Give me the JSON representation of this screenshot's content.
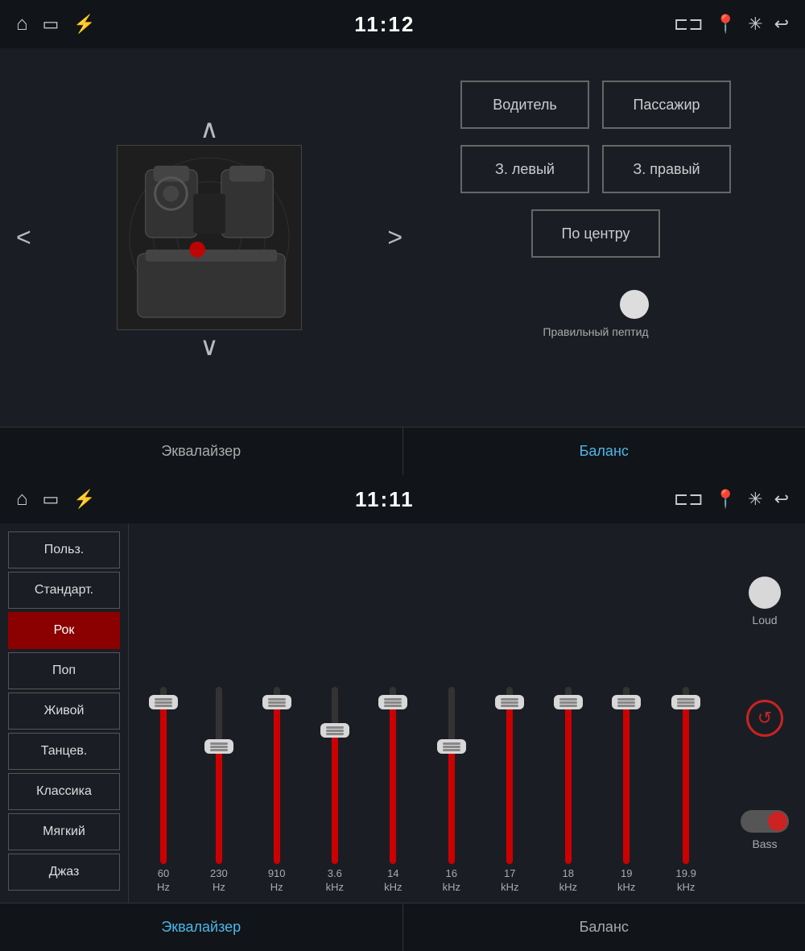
{
  "top": {
    "statusBar": {
      "time": "11:12"
    },
    "tabs": [
      {
        "label": "Эквалайзер",
        "active": false
      },
      {
        "label": "Баланс",
        "active": true
      }
    ],
    "balanceControls": {
      "up": "∧",
      "down": "∨",
      "left": "<",
      "right": ">",
      "btn_driver": "Водитель",
      "btn_passenger": "Пассажир",
      "btn_rear_left": "З. левый",
      "btn_rear_right": "З. правый",
      "btn_center": "По центру",
      "label_correct": "Правильный пептид"
    }
  },
  "bottom": {
    "statusBar": {
      "time": "11:11"
    },
    "presets": [
      {
        "label": "Польз.",
        "active": false
      },
      {
        "label": "Стандарт.",
        "active": false
      },
      {
        "label": "Рок",
        "active": true
      },
      {
        "label": "Поп",
        "active": false
      },
      {
        "label": "Живой",
        "active": false
      },
      {
        "label": "Танцев.",
        "active": false
      },
      {
        "label": "Классика",
        "active": false
      },
      {
        "label": "Мягкий",
        "active": false
      },
      {
        "label": "Джаз",
        "active": false
      }
    ],
    "sliders": [
      {
        "freq": "60",
        "unit": "Hz",
        "fill": 88,
        "thumbTop": 10
      },
      {
        "freq": "230",
        "unit": "Hz",
        "fill": 65,
        "thumbTop": 65
      },
      {
        "freq": "910",
        "unit": "Hz",
        "fill": 88,
        "thumbTop": 10
      },
      {
        "freq": "3.6",
        "unit": "kHz",
        "fill": 75,
        "thumbTop": 45
      },
      {
        "freq": "14",
        "unit": "kHz",
        "fill": 88,
        "thumbTop": 10
      },
      {
        "freq": "16",
        "unit": "kHz",
        "fill": 65,
        "thumbTop": 65
      },
      {
        "freq": "17",
        "unit": "kHz",
        "fill": 88,
        "thumbTop": 10
      },
      {
        "freq": "18",
        "unit": "kHz",
        "fill": 88,
        "thumbTop": 10
      },
      {
        "freq": "19",
        "unit": "kHz",
        "fill": 88,
        "thumbTop": 10
      },
      {
        "freq": "19.9",
        "unit": "kHz",
        "fill": 88,
        "thumbTop": 10
      }
    ],
    "controls": {
      "loud": "Loud",
      "bass": "Bass",
      "reset_icon": "↺"
    },
    "tabs": [
      {
        "label": "Эквалайзер",
        "active": true
      },
      {
        "label": "Баланс",
        "active": false
      }
    ]
  }
}
